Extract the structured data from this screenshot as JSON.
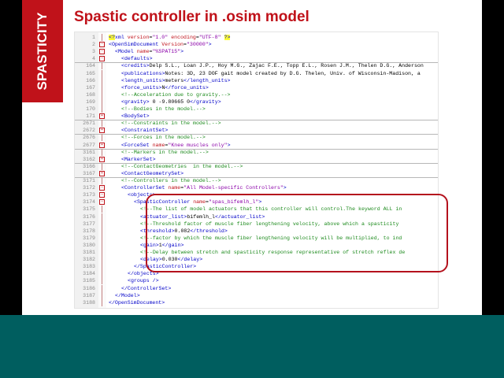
{
  "slide": {
    "side_label": "SPASTICITY",
    "title": "Spastic controller in .osim model"
  },
  "editor": {
    "lines": [
      {
        "ln": "1",
        "indent": 0,
        "fold": "",
        "html": "<span class='pi'>&lt;?</span><span class='tag'>xml</span> <span class='attr'>version</span>=<span class='val'>\"1.0\"</span> <span class='attr'>encoding</span>=<span class='val'>\"UTF-8\"</span> <span class='pi'>?&gt;</span>"
      },
      {
        "ln": "2",
        "indent": 0,
        "fold": "-",
        "html": "<span class='tag'>&lt;OpenSimDocument</span> <span class='attr'>Version</span>=<span class='val'>\"30000\"</span><span class='tag'>&gt;</span>"
      },
      {
        "ln": "3",
        "indent": 1,
        "fold": "-",
        "html": "<span class='tag'>&lt;Model</span> <span class='attr'>name</span>=<span class='val'>\"%SPAT15\"</span><span class='tag'>&gt;</span>"
      },
      {
        "ln": "4",
        "indent": 2,
        "fold": "-",
        "html": "<span class='tag'>&lt;defaults&gt;</span>",
        "sep": true
      },
      {
        "ln": "164",
        "indent": 2,
        "fold": "",
        "html": "<span class='tag'>&lt;credits&gt;</span>Delp S.L., Loan J.P., Hoy M.G., Zajac F.E., Topp E.L., Rosen J.M., Thelen D.G., Anderson"
      },
      {
        "ln": "165",
        "indent": 2,
        "fold": "",
        "html": "<span class='tag'>&lt;publications&gt;</span>Notes: 3D, 23 DOF gait model created by D.G. Thelen, Univ. of Wisconsin-Madison, a"
      },
      {
        "ln": "166",
        "indent": 2,
        "fold": "",
        "html": "<span class='tag'>&lt;length_units&gt;</span>meters<span class='tag'>&lt;/length_units&gt;</span>"
      },
      {
        "ln": "167",
        "indent": 2,
        "fold": "",
        "html": "<span class='tag'>&lt;force_units&gt;</span>N<span class='tag'>&lt;/force_units&gt;</span>"
      },
      {
        "ln": "168",
        "indent": 2,
        "fold": "",
        "html": "<span class='cmt'>&lt;!--Acceleration due to gravity.--&gt;</span>"
      },
      {
        "ln": "169",
        "indent": 2,
        "fold": "",
        "html": "<span class='tag'>&lt;gravity&gt;</span> 0 -9.80665 0<span class='tag'>&lt;/gravity&gt;</span>"
      },
      {
        "ln": "170",
        "indent": 2,
        "fold": "",
        "html": "<span class='cmt'>&lt;!--Bodies in the model.--&gt;</span>"
      },
      {
        "ln": "171",
        "indent": 2,
        "fold": "+",
        "html": "<span class='tag'>&lt;BodySet&gt;</span>",
        "sep": true
      },
      {
        "ln": "2671",
        "indent": 2,
        "fold": "",
        "html": "<span class='cmt'>&lt;!--Constraints in the model.--&gt;</span>"
      },
      {
        "ln": "2672",
        "indent": 2,
        "fold": "+",
        "html": "<span class='tag'>&lt;ConstraintSet&gt;</span>",
        "sep": true
      },
      {
        "ln": "2676",
        "indent": 2,
        "fold": "",
        "html": "<span class='cmt'>&lt;!--Forces in the model.--&gt;</span>"
      },
      {
        "ln": "2677",
        "indent": 2,
        "fold": "+",
        "html": "<span class='tag'>&lt;ForceSet</span> <span class='attr'>name</span>=<span class='val'>\"Knee muscles only\"</span><span class='tag'>&gt;</span>",
        "sep": true
      },
      {
        "ln": "3161",
        "indent": 2,
        "fold": "",
        "html": "<span class='cmt'>&lt;!--Markers in the model.--&gt;</span>"
      },
      {
        "ln": "3162",
        "indent": 2,
        "fold": "+",
        "html": "<span class='tag'>&lt;MarkerSet&gt;</span>",
        "sep": true
      },
      {
        "ln": "3166",
        "indent": 2,
        "fold": "",
        "html": "<span class='cmt'>&lt;!--ContactGeometries  in the model.--&gt;</span>"
      },
      {
        "ln": "3167",
        "indent": 2,
        "fold": "+",
        "html": "<span class='tag'>&lt;ContactGeometrySet&gt;</span>",
        "sep": true
      },
      {
        "ln": "3171",
        "indent": 2,
        "fold": "",
        "html": "<span class='cmt'>&lt;!--Controllers in the model.--&gt;</span>"
      },
      {
        "ln": "3172",
        "indent": 2,
        "fold": "-",
        "html": "<span class='tag'>&lt;ControllerSet</span> <span class='attr'>name</span>=<span class='val'>\"All Model-specific Controllers\"</span><span class='tag'>&gt;</span>"
      },
      {
        "ln": "3173",
        "indent": 3,
        "fold": "-",
        "html": "<span class='tag'>&lt;objects&gt;</span>"
      },
      {
        "ln": "3174",
        "indent": 4,
        "fold": "-",
        "html": "<span class='tag'>&lt;SpasticController</span> <span class='attr'>name</span>=<span class='val'>\"spas_bifemlh_l\"</span><span class='tag'>&gt;</span>"
      },
      {
        "ln": "3175",
        "indent": 5,
        "fold": "",
        "html": "<span class='cmt'>&lt;!--The list of model actuators that this controller will control.The keyword ALL in</span>"
      },
      {
        "ln": "3176",
        "indent": 5,
        "fold": "",
        "html": "<span class='tag'>&lt;actuator_list&gt;</span>bifemlh_l<span class='tag'>&lt;/actuator_list&gt;</span>"
      },
      {
        "ln": "3177",
        "indent": 5,
        "fold": "",
        "html": "<span class='cmt'>&lt;!--Threshold factor of muscle fiber lengthening velocity, above which a spasticity</span>"
      },
      {
        "ln": "3178",
        "indent": 5,
        "fold": "",
        "html": "<span class='tag'>&lt;threshold&gt;</span>0.082<span class='tag'>&lt;/threshold&gt;</span>"
      },
      {
        "ln": "3179",
        "indent": 5,
        "fold": "",
        "html": "<span class='cmt'>&lt;!--factor by which the muscle fiber lengthening velocity will be multiplied, to ind</span>"
      },
      {
        "ln": "3180",
        "indent": 5,
        "fold": "",
        "html": "<span class='tag'>&lt;gain&gt;</span>1<span class='tag'>&lt;/gain&gt;</span>"
      },
      {
        "ln": "3181",
        "indent": 5,
        "fold": "",
        "html": "<span class='cmt'>&lt;!--Delay between stretch and spasticity response representative of stretch reflex de</span>"
      },
      {
        "ln": "3182",
        "indent": 5,
        "fold": "",
        "html": "<span class='tag'>&lt;delay&gt;</span>0.030<span class='tag'>&lt;/delay&gt;</span>"
      },
      {
        "ln": "3183",
        "indent": 4,
        "fold": "",
        "html": "<span class='tag'>&lt;/SpasticController&gt;</span>"
      },
      {
        "ln": "3184",
        "indent": 3,
        "fold": "",
        "html": "<span class='tag'>&lt;/objects&gt;</span>"
      },
      {
        "ln": "3185",
        "indent": 3,
        "fold": "",
        "html": "<span class='tag'>&lt;groups /&gt;</span>"
      },
      {
        "ln": "3186",
        "indent": 2,
        "fold": "",
        "html": "<span class='tag'>&lt;/ControllerSet&gt;</span>"
      },
      {
        "ln": "3187",
        "indent": 1,
        "fold": "",
        "html": "<span class='tag'>&lt;/Model&gt;</span>"
      },
      {
        "ln": "3188",
        "indent": 0,
        "fold": "",
        "html": "<span class='tag'>&lt;/OpenSimDocument&gt;</span>"
      }
    ]
  },
  "colors": {
    "accent_red": "#c0121a",
    "bottom_teal": "#005e5f",
    "xml_tag": "#0000c8",
    "xml_comment": "#1c8a1c"
  }
}
